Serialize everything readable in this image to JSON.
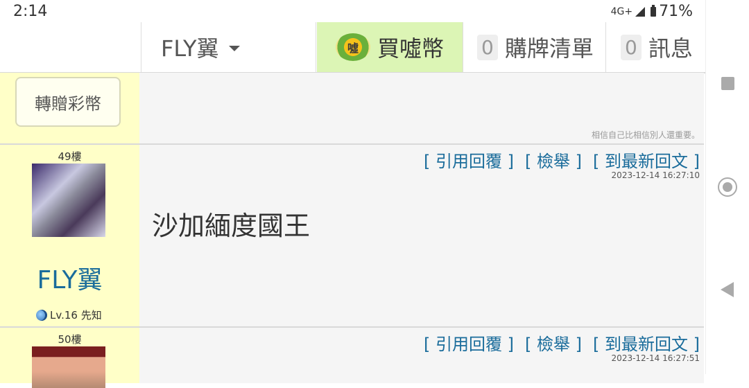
{
  "status_bar": {
    "time": "2:14",
    "network": "4G+",
    "battery_percent": "71%"
  },
  "nav": {
    "username": "FLY翼",
    "buy_label": "買噓幣",
    "buy_coin_icon_text": "噓",
    "list_count": "0",
    "list_label": "購牌清單",
    "msg_count": "0",
    "msg_label": "訊息"
  },
  "gift_row": {
    "gift_button": "轉贈彩幣",
    "signature": "相信自己比相信別人還重要。"
  },
  "posts": [
    {
      "floor": "49樓",
      "username": "FLY翼",
      "level": "Lv.16 先知",
      "actions": {
        "quote": "[ 引用回覆 ]",
        "report": "[ 檢舉 ]",
        "latest": "[ 到最新回文 ]"
      },
      "timestamp": "2023-12-14 16:27:10",
      "content": "沙加緬度國王"
    },
    {
      "floor": "50樓",
      "actions": {
        "quote": "[ 引用回覆 ]",
        "report": "[ 檢舉 ]",
        "latest": "[ 到最新回文 ]"
      },
      "timestamp": "2023-12-14 16:27:51"
    }
  ],
  "colors": {
    "link_blue": "#1a6c9b",
    "sidebar_yellow": "#ffffc8",
    "buy_green": "#dcf5b5"
  }
}
